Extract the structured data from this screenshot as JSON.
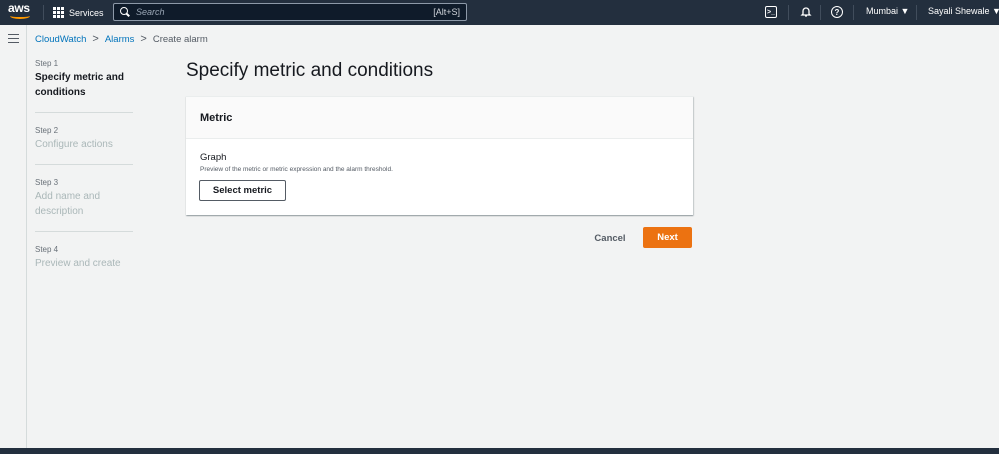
{
  "topnav": {
    "logo_text": "aws",
    "services_label": "Services",
    "search_placeholder": "Search",
    "search_shortcut": "[Alt+S]",
    "region": "Mumbai ▼",
    "user": "Sayali Shewale ▼",
    "cloudshell_glyph": ">_",
    "help_glyph": "?"
  },
  "breadcrumb": {
    "items": [
      "CloudWatch",
      "Alarms"
    ],
    "separator": ">",
    "current": "Create alarm"
  },
  "steps": [
    {
      "num": "Step 1",
      "title": "Specify metric and conditions"
    },
    {
      "num": "Step 2",
      "title": "Configure actions"
    },
    {
      "num": "Step 3",
      "title": "Add name and description"
    },
    {
      "num": "Step 4",
      "title": "Preview and create"
    }
  ],
  "main": {
    "page_title": "Specify metric and conditions",
    "metric_header": "Metric",
    "graph_label": "Graph",
    "graph_description": "Preview of the metric or metric expression and the alarm threshold.",
    "select_metric_label": "Select metric",
    "cancel_label": "Cancel",
    "next_label": "Next"
  },
  "colors": {
    "nav_bg": "#232f3e",
    "link": "#0073bb",
    "primary_button": "#ec7211",
    "page_bg": "#f2f3f3"
  }
}
